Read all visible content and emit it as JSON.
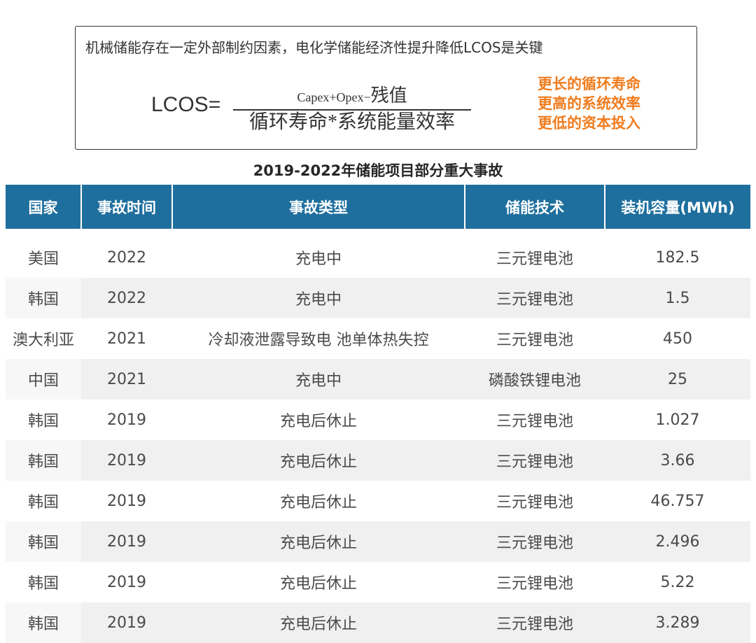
{
  "formula_box": {
    "heading": "机械储能存在一定外部制约因素，电化学储能经济性提升降低LCOS是关键",
    "lcos_label": "LCOS=",
    "numerator": "Capex+Opex−",
    "numerator_residual": "残值",
    "denominator": "循环寿命*系统能量效率",
    "benefits": [
      "更长的循环寿命",
      "更高的系统效率",
      "更低的资本投入"
    ],
    "accent_color": "#f07c1e"
  },
  "table": {
    "title": "2019-2022年储能项目部分重大事故",
    "header_color": "#1f6f9e",
    "headers": [
      "国家",
      "事故时间",
      "事故类型",
      "储能技术",
      "装机容量(MWh)"
    ],
    "rows": [
      [
        "美国",
        "2022",
        "充电中",
        "三元锂电池",
        "182.5"
      ],
      [
        "韩国",
        "2022",
        "充电中",
        "三元锂电池",
        "1.5"
      ],
      [
        "澳大利亚",
        "2021",
        "冷却液泄露导致电  池单体热失控",
        "三元锂电池",
        "450"
      ],
      [
        "中国",
        "2021",
        "充电中",
        "磷酸铁锂电池",
        "25"
      ],
      [
        "韩国",
        "2019",
        "充电后休止",
        "三元锂电池",
        "1.027"
      ],
      [
        "韩国",
        "2019",
        "充电后休止",
        "三元锂电池",
        "3.66"
      ],
      [
        "韩国",
        "2019",
        "充电后休止",
        "三元锂电池",
        "46.757"
      ],
      [
        "韩国",
        "2019",
        "充电后休止",
        "三元锂电池",
        "2.496"
      ],
      [
        "韩国",
        "2019",
        "充电后休止",
        "三元锂电池",
        "5.22"
      ],
      [
        "韩国",
        "2019",
        "充电后休止",
        "三元锂电池",
        "3.289"
      ]
    ]
  }
}
